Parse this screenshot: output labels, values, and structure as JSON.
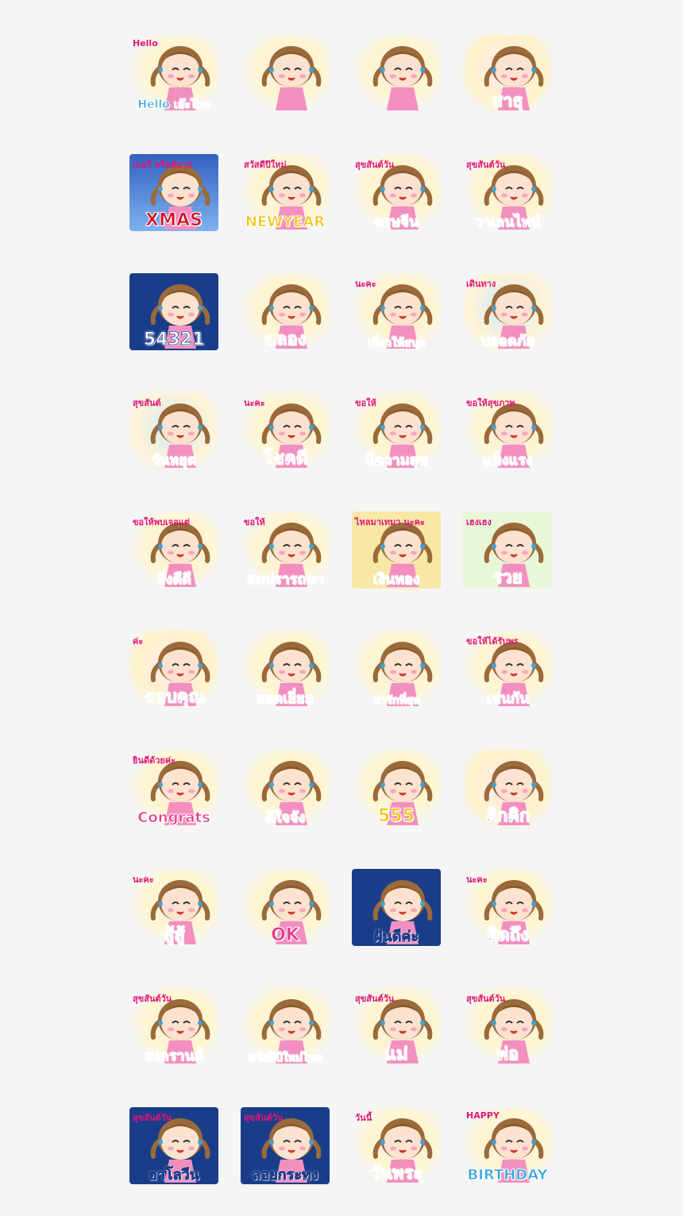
{
  "stickers": [
    {
      "label": "Hello เอ๊ะโหล",
      "sub": "Hello",
      "bg": "blob",
      "color": "c-default"
    },
    {
      "label": "",
      "sub": "",
      "bg": "blob",
      "color": "c-red"
    },
    {
      "label": "",
      "sub": "",
      "bg": "blob",
      "color": "c-pink"
    },
    {
      "label": "สาธุ",
      "sub": "",
      "bg": "pink",
      "color": "c-orange"
    },
    {
      "label": "XMAS",
      "sub": "เมอรี่ คริสต์มาส",
      "bg": "xmas",
      "color": "c-red"
    },
    {
      "label": "NEWYEAR",
      "sub": "สวัสดีปีใหม่",
      "bg": "blob",
      "color": "c-yellow"
    },
    {
      "label": "ตรุษจีน",
      "sub": "สุขสันต์วัน",
      "bg": "blob",
      "color": "c-red"
    },
    {
      "label": "วาเลนไทน์",
      "sub": "สุขสันต์วัน",
      "bg": "blob",
      "color": "c-red"
    },
    {
      "label": "54321",
      "sub": "",
      "bg": "dark",
      "color": "c-white"
    },
    {
      "label": "ฉลอง",
      "sub": "",
      "bg": "blob",
      "color": "c-purple"
    },
    {
      "label": "เที่ยวให้สนุก",
      "sub": "นะคะ",
      "bg": "blob",
      "color": "c-default"
    },
    {
      "label": "ปลอดภัย",
      "sub": "เดินทาง",
      "bg": "sky",
      "color": "c-orange"
    },
    {
      "label": "วันหยุด",
      "sub": "สุขสันต์",
      "bg": "sky",
      "color": "c-default"
    },
    {
      "label": "โชคดี",
      "sub": "นะคะ",
      "bg": "blob",
      "color": "c-pink"
    },
    {
      "label": "มีความสุข",
      "sub": "ขอให้",
      "bg": "blob",
      "color": "c-default"
    },
    {
      "label": "แข็งแรง",
      "sub": "ขอให้สุขภาพ",
      "bg": "blob",
      "color": "c-default"
    },
    {
      "label": "สิ่งดีดี",
      "sub": "ขอให้พบเจอแต่",
      "bg": "blob",
      "color": "c-green"
    },
    {
      "label": "สมปรารถนา",
      "sub": "ขอให้",
      "bg": "blob",
      "color": "c-default"
    },
    {
      "label": "เงินทอง",
      "sub": "ไหลมาเทมา นะคะ",
      "bg": "gold",
      "color": "c-yellow"
    },
    {
      "label": "รวย",
      "sub": "เฮงเฮง",
      "bg": "green",
      "color": "c-yellow"
    },
    {
      "label": "ขอบคุณ",
      "sub": "ค่ะ",
      "bg": "pink",
      "color": "c-default"
    },
    {
      "label": "ยอดเยี่ยม",
      "sub": "",
      "bg": "blob",
      "color": "c-pink"
    },
    {
      "label": "น่ารักที่สุด",
      "sub": "",
      "bg": "blob",
      "color": "c-pink"
    },
    {
      "label": "เช่นกัน",
      "sub": "ขอให้ได้รับพร",
      "bg": "blob",
      "color": "c-pink"
    },
    {
      "label": "Congrats",
      "sub": "ยินดีด้วยค่ะ",
      "bg": "blob",
      "color": "c-pink"
    },
    {
      "label": "ดีใจจัง",
      "sub": "",
      "bg": "blob",
      "color": "c-default"
    },
    {
      "label": "555",
      "sub": "",
      "bg": "blob",
      "color": "c-yellow"
    },
    {
      "label": "คิกคิก",
      "sub": "",
      "bg": "pink",
      "color": "c-default"
    },
    {
      "label": "สู้สู้",
      "sub": "นะคะ",
      "bg": "blob",
      "color": "c-green"
    },
    {
      "label": "OK",
      "sub": "",
      "bg": "blob",
      "color": "c-pink"
    },
    {
      "label": "ฝันดีค่ะ",
      "sub": "",
      "bg": "dark",
      "color": "c-white"
    },
    {
      "label": "คิดถึง",
      "sub": "นะคะ",
      "bg": "blob",
      "color": "c-default"
    },
    {
      "label": "สงกรานต์",
      "sub": "สุขสันต์วัน",
      "bg": "blob",
      "color": "c-orange"
    },
    {
      "label": "สวัสดีปีใหม่ไทย",
      "sub": "",
      "bg": "blob",
      "color": "c-default"
    },
    {
      "label": "แม่",
      "sub": "สุขสันต์วัน",
      "bg": "blob",
      "color": "c-default"
    },
    {
      "label": "พ่อ",
      "sub": "สุขสันต์วัน",
      "bg": "blob",
      "color": "c-orange"
    },
    {
      "label": "ฮาโลวีน",
      "sub": "สุขสันต์วัน",
      "bg": "dark",
      "color": "c-white"
    },
    {
      "label": "ลอยกระทง",
      "sub": "สุขสันต์วัน",
      "bg": "dark",
      "color": "c-white"
    },
    {
      "label": "วันพระ",
      "sub": "วันนี้",
      "bg": "blob",
      "color": "c-yellow"
    },
    {
      "label": "BIRTHDAY",
      "sub": "HAPPY",
      "bg": "blob",
      "color": "c-default"
    }
  ]
}
